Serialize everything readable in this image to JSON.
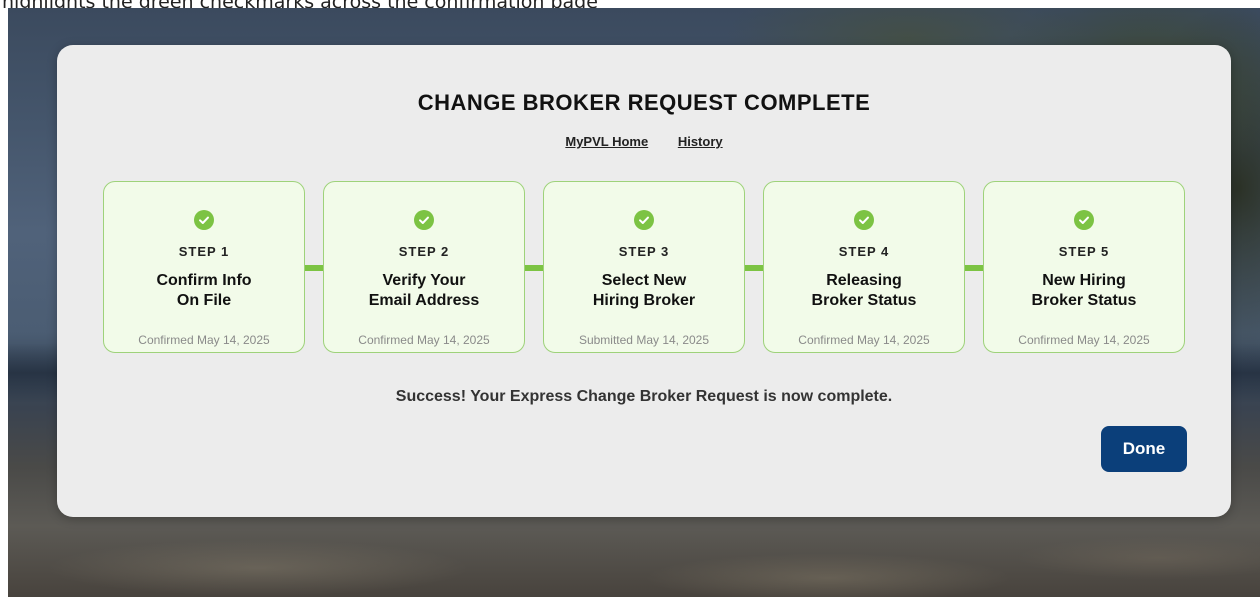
{
  "banner": {
    "text": "highlights the green checkmarks across the confirmation page"
  },
  "modal": {
    "title": "CHANGE BROKER REQUEST COMPLETE",
    "links": [
      {
        "label": "MyPVL Home"
      },
      {
        "label": "History"
      }
    ],
    "steps": [
      {
        "number": "STEP 1",
        "line1": "Confirm Info",
        "line2": "On File",
        "status": "Confirmed May 14, 2025",
        "state": "complete"
      },
      {
        "number": "STEP 2",
        "line1": "Verify Your",
        "line2": "Email Address",
        "status": "Confirmed May 14, 2025",
        "state": "complete"
      },
      {
        "number": "STEP 3",
        "line1": "Select New",
        "line2": "Hiring Broker",
        "status": "Submitted May 14, 2025",
        "state": "complete"
      },
      {
        "number": "STEP 4",
        "line1": "Releasing",
        "line2": "Broker Status",
        "status": "Confirmed May 14, 2025",
        "state": "complete"
      },
      {
        "number": "STEP 5",
        "line1": "New Hiring",
        "line2": "Broker Status",
        "status": "Confirmed May 14, 2025",
        "state": "complete"
      }
    ],
    "success_message": "Success! Your Express Change Broker Request is now complete.",
    "done_label": "Done"
  },
  "icons": {
    "step_check": "check-circle-icon"
  },
  "colors": {
    "accent_green": "#7cc343",
    "step_background": "#f2fbe9",
    "step_border": "#9ed27a",
    "primary_button": "#0b3f7a",
    "modal_background": "#ececec"
  }
}
